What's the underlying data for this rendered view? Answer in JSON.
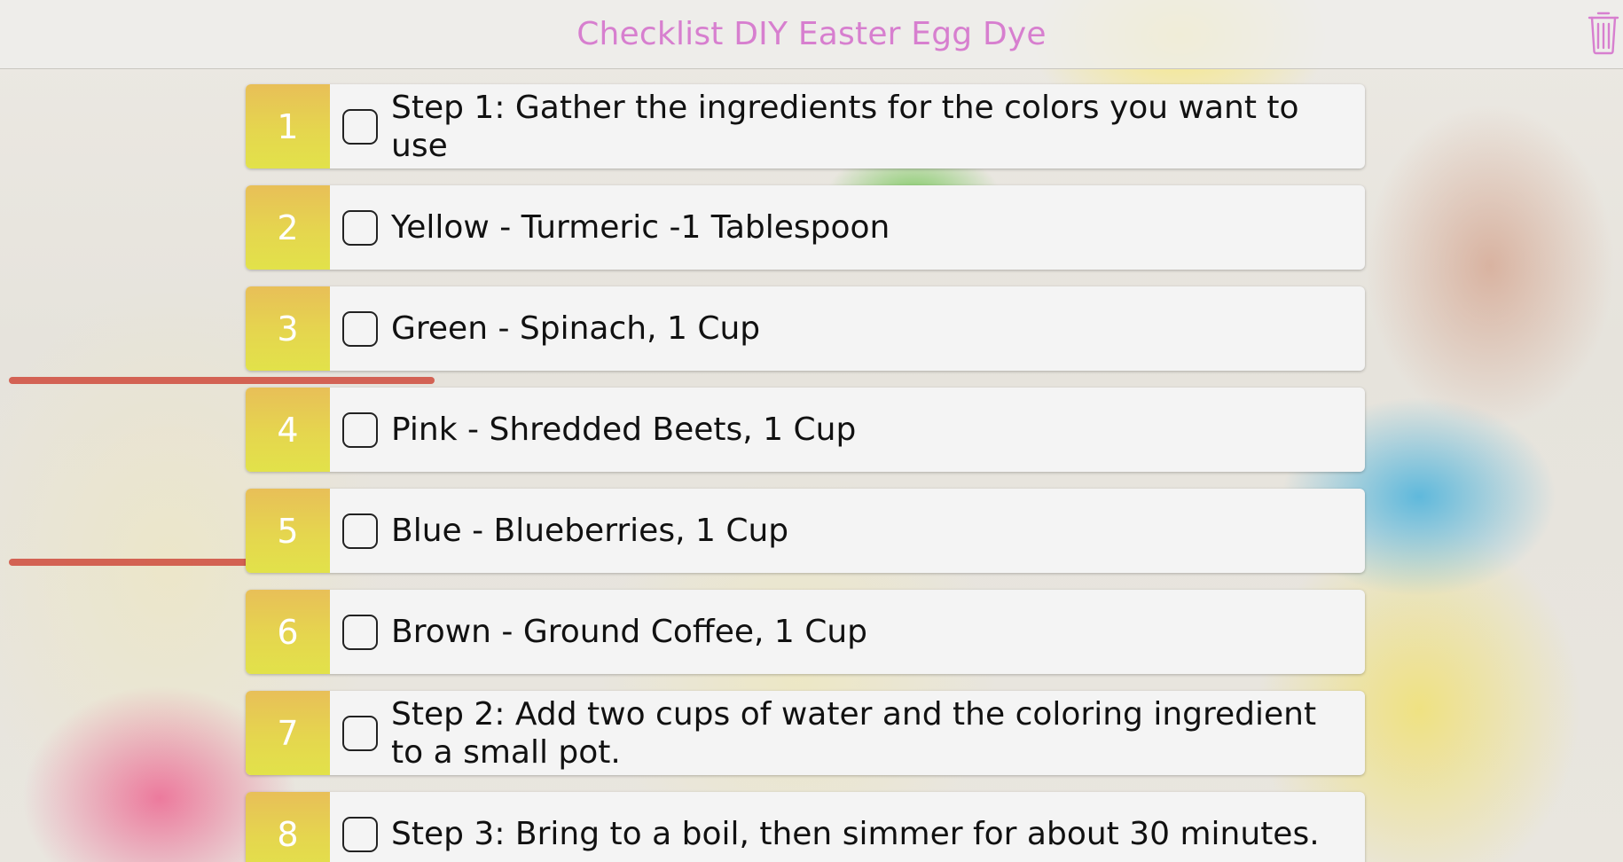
{
  "header": {
    "title": "Checklist DIY Easter Egg Dye",
    "trash_icon": "trash-icon"
  },
  "colors": {
    "title": "#d77fcf",
    "number_badge_top": "#e8bf58",
    "number_badge_bottom": "#e2e24a",
    "row_background": "#f4f4f4"
  },
  "items": [
    {
      "number": "1",
      "text": "Step 1: Gather the ingredients for the colors you want to use",
      "checked": false
    },
    {
      "number": "2",
      "text": "Yellow - Turmeric -1 Tablespoon",
      "checked": false
    },
    {
      "number": "3",
      "text": "Green - Spinach, 1 Cup",
      "checked": false
    },
    {
      "number": "4",
      "text": "Pink - Shredded Beets, 1 Cup",
      "checked": false
    },
    {
      "number": "5",
      "text": "Blue - Blueberries, 1 Cup",
      "checked": false
    },
    {
      "number": "6",
      "text": "Brown - Ground Coffee, 1 Cup",
      "checked": false
    },
    {
      "number": "7",
      "text": "Step 2: Add two cups of water and the coloring ingredient to a small pot.",
      "checked": false
    },
    {
      "number": "8",
      "text": "Step 3: Bring to a boil, then simmer for about 30 minutes.",
      "checked": false
    }
  ]
}
